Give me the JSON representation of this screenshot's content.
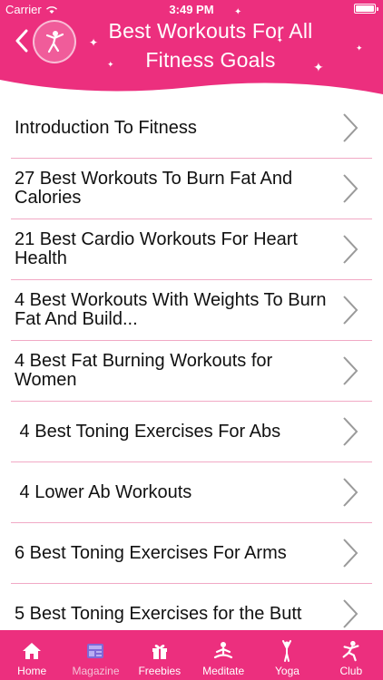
{
  "status_bar": {
    "carrier": "Carrier",
    "time": "3:49 PM"
  },
  "header": {
    "title": "Best Workouts For All Fitness Goals"
  },
  "items": [
    {
      "label": "Introduction To Fitness"
    },
    {
      "label": "27 Best Workouts To Burn Fat And Calories"
    },
    {
      "label": "21 Best Cardio Workouts For Heart Health"
    },
    {
      "label": "4 Best Workouts With Weights To Burn Fat And Build..."
    },
    {
      "label": "4 Best Fat Burning Workouts for Women"
    },
    {
      "label": " 4 Best Toning Exercises For Abs"
    },
    {
      "label": " 4 Lower Ab Workouts"
    },
    {
      "label": "6 Best Toning Exercises For Arms"
    },
    {
      "label": "5 Best Toning Exercises for the Butt"
    }
  ],
  "tabs": [
    {
      "label": "Home",
      "icon": "home-icon"
    },
    {
      "label": "Magazine",
      "icon": "magazine-icon"
    },
    {
      "label": "Freebies",
      "icon": "gift-icon"
    },
    {
      "label": "Meditate",
      "icon": "meditate-icon"
    },
    {
      "label": "Yoga",
      "icon": "yoga-icon"
    },
    {
      "label": "Club",
      "icon": "club-icon"
    }
  ],
  "active_tab": "Magazine",
  "colors": {
    "accent": "#ec2f7e",
    "divider": "#f1a9c5",
    "inactive_tab": "#f5c1d6"
  }
}
